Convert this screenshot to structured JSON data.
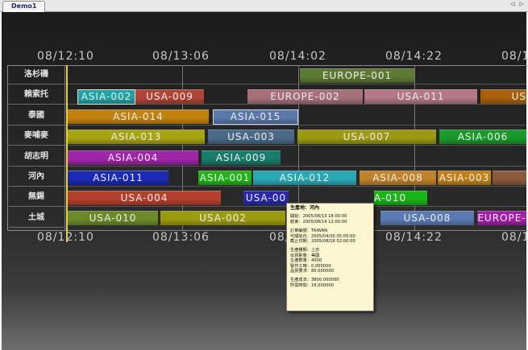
{
  "tab": {
    "label": "Demo1"
  },
  "nav": {
    "arrows": "◁ ▷"
  },
  "timeline": {
    "top": [
      "08/12:10",
      "08/13:06",
      "08/14:02",
      "08/14:22",
      "08/1"
    ],
    "bottom": [
      "08/12:10",
      "08/13:06",
      "08/14:02",
      "08/14:22",
      "08/1"
    ]
  },
  "rows": [
    "洛杉磯",
    "賴索托",
    "泰國",
    "麥哺麥",
    "胡志明",
    "河內",
    "無錫",
    "土城"
  ],
  "bars": [
    {
      "row": 0,
      "label": "EUROPE-001",
      "color": "#5c7a34"
    },
    {
      "row": 1,
      "label": "ASIA-002",
      "color": "#1fa3a3"
    },
    {
      "row": 1,
      "label": "USA-009",
      "color": "#b04436"
    },
    {
      "row": 1,
      "label": "EUROPE-002",
      "color": "#a8707a"
    },
    {
      "row": 1,
      "label": "USA-011",
      "color": "#b47886"
    },
    {
      "row": 1,
      "label": "US",
      "color": "#a8600c"
    },
    {
      "row": 2,
      "label": "ASIA-014",
      "color": "#c2820e"
    },
    {
      "row": 2,
      "label": "ASIA-015",
      "color": "#5a78a8"
    },
    {
      "row": 3,
      "label": "ASIA-013",
      "color": "#a6a410"
    },
    {
      "row": 3,
      "label": "USA-003",
      "color": "#4a6a8a"
    },
    {
      "row": 3,
      "label": "USA-007",
      "color": "#9c9a12"
    },
    {
      "row": 3,
      "label": "ASIA-006",
      "color": "#1a9a2a"
    },
    {
      "row": 4,
      "label": "ASIA-004",
      "color": "#a026a8"
    },
    {
      "row": 4,
      "label": "ASIA-009",
      "color": "#1a7c6c"
    },
    {
      "row": 5,
      "label": "ASIA-011",
      "color": "#1a2ab4"
    },
    {
      "row": 5,
      "label": "ASIA-001",
      "color": "#22b41a"
    },
    {
      "row": 5,
      "label": "ASIA-012",
      "color": "#2aa8b4"
    },
    {
      "row": 5,
      "label": "ASIA-008",
      "color": "#c0822a"
    },
    {
      "row": 5,
      "label": "ASIA-003",
      "color": "#c08218"
    },
    {
      "row": 5,
      "label": "",
      "color": "#8a5a3a"
    },
    {
      "row": 6,
      "label": "USA-004",
      "color": "#b4402e"
    },
    {
      "row": 6,
      "label": "USA-00",
      "color": "#2a2aa8"
    },
    {
      "row": 6,
      "label": "A-010",
      "color": "#1ab41a"
    },
    {
      "row": 7,
      "label": "USA-010",
      "color": "#6a8a2a"
    },
    {
      "row": 7,
      "label": "USA-002",
      "color": "#9a9a10"
    },
    {
      "row": 7,
      "label": "USA-008",
      "color": "#5a7ab4"
    },
    {
      "row": 7,
      "label": "EUROPE-",
      "color": "#a020a8"
    }
  ],
  "tooltip": {
    "title": "生產地：河內",
    "start": "開始：2005/08/13 18:00:00",
    "end": "結束：2005/08/14 12:00:00",
    "order": "訂單編號：TAIWAN",
    "planned": "可開始日：2005/04/30 05:00:00",
    "due": "截止日期：2005/08/16 02:00:00",
    "kind": "生產種類：上衣",
    "brand": "出貨對象：美國",
    "qty": "生產數量：4000",
    "hours": "製作工時：0.000000",
    "quality": "品質要求：80.000000",
    "cost": "生產成本：3800.000000",
    "time": "所需時間：18.000000"
  }
}
